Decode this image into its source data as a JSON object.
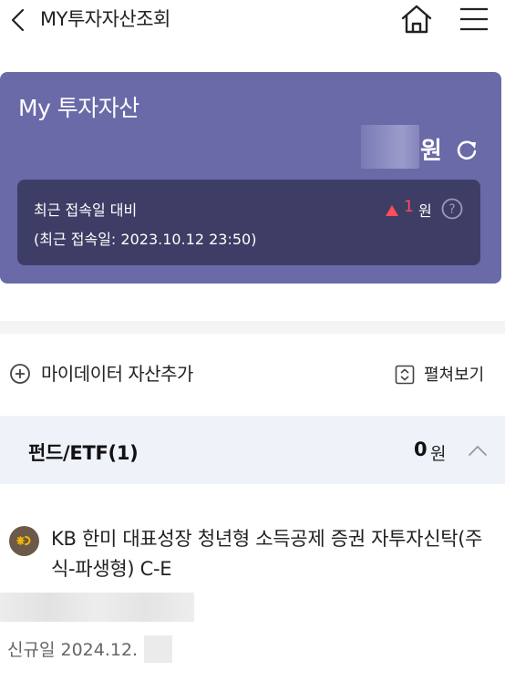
{
  "header": {
    "title": "MY투자자산조회",
    "icons": {
      "back": "chevron-left-icon",
      "home": "home-icon",
      "menu": "hamburger-menu-icon"
    }
  },
  "asset_card": {
    "title": "My 투자자산",
    "amount_unit": "원",
    "comparison": {
      "label": "최근 접속일 대비",
      "last_access": "(최근 접속일: 2023.10.12 23:50)",
      "change_value": "1",
      "change_unit": "원"
    },
    "colors": {
      "card": "#6a6aa9",
      "box": "#3e3d65",
      "up": "#ff4d57"
    }
  },
  "actions": {
    "add_label": "마이데이터 자산추가",
    "expand_label": "펼쳐보기"
  },
  "fund_section": {
    "title": "펀드/ETF(1)",
    "amount": "0",
    "unit": "원",
    "background": "#eef2f9"
  },
  "product": {
    "name": "KB 한미 대표성장 청년형 소득공제 증권 자투자신탁(주식-파생형) C-E",
    "open_date": "신규일 2024.12."
  }
}
